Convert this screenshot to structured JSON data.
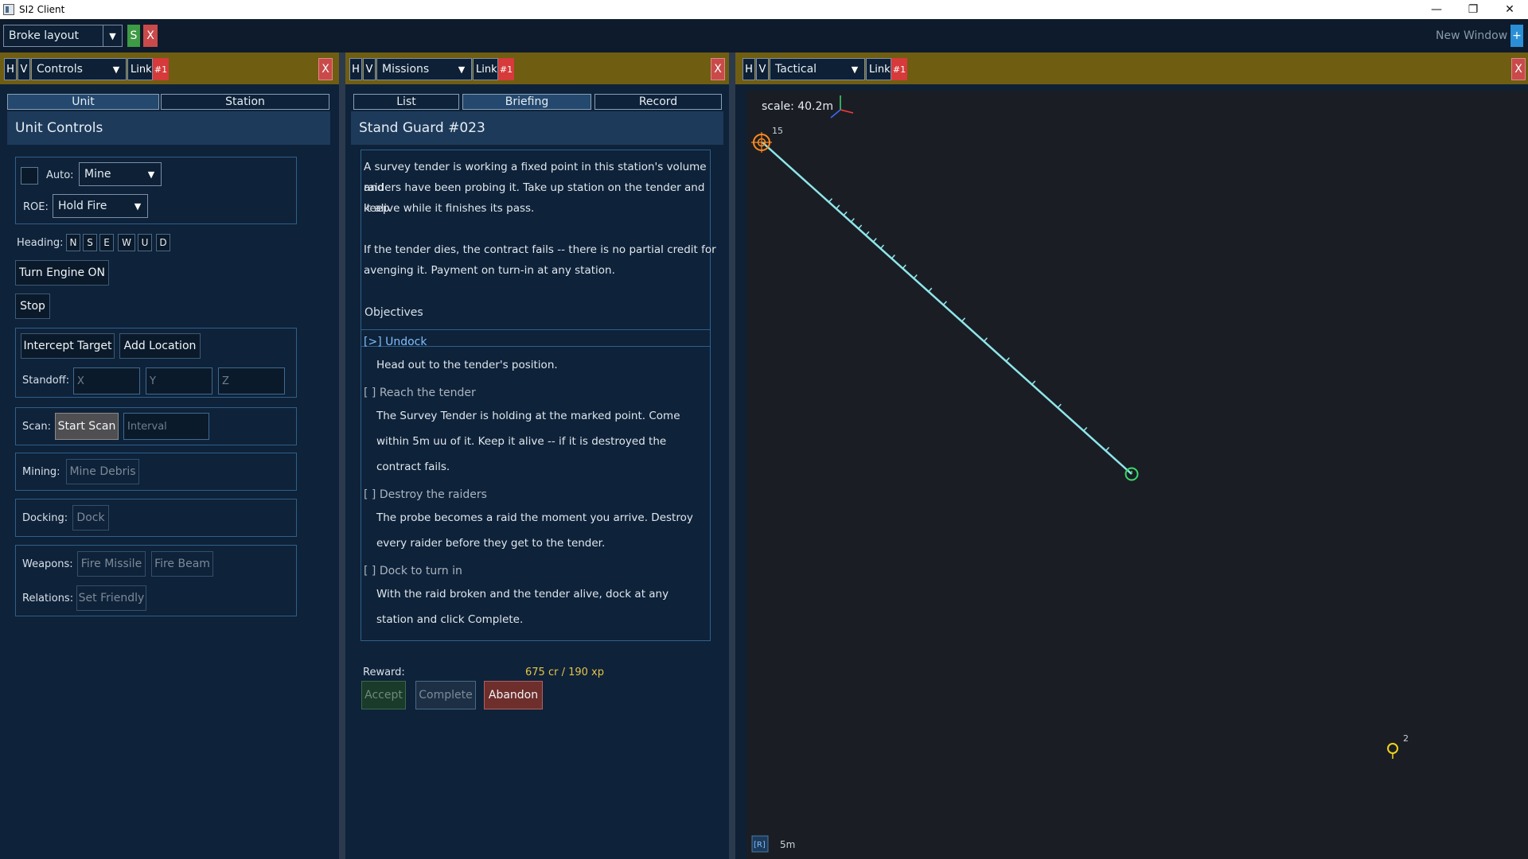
{
  "window": {
    "title": "SI2 Client",
    "controls": [
      "—",
      "❐",
      "✕"
    ]
  },
  "toolbar": {
    "layout_value": "Broke layout",
    "save_label": "S",
    "close_label": "X",
    "new_window_label": "New Window",
    "new_window_plus": "+"
  },
  "panel_header": {
    "h": "H",
    "v": "V",
    "link": "Link",
    "badge": "#1",
    "close": "X"
  },
  "controls": {
    "view_value": "Controls",
    "tabs": [
      "Unit",
      "Station"
    ],
    "title": "Unit Controls",
    "auto_label": "Auto:",
    "auto_value": "Mine",
    "roe_label": "ROE:",
    "roe_value": "Hold Fire",
    "heading_label": "Heading:",
    "headings": [
      "N",
      "S",
      "E",
      "W",
      "U",
      "D"
    ],
    "engine_button": "Turn Engine ON",
    "stop_button": "Stop",
    "intercept_button": "Intercept Target",
    "add_location_button": "Add Location",
    "standoff_label": "Standoff:",
    "standoff_placeholders": [
      "X",
      "Y",
      "Z"
    ],
    "scan_label": "Scan:",
    "start_scan_button": "Start Scan",
    "interval_placeholder": "Interval",
    "mining_label": "Mining:",
    "mine_debris_button": "Mine Debris",
    "docking_label": "Docking:",
    "dock_button": "Dock",
    "weapons_label": "Weapons:",
    "fire_missile_button": "Fire Missile",
    "fire_beam_button": "Fire Beam",
    "relations_label": "Relations:",
    "set_friendly_button": "Set Friendly"
  },
  "missions": {
    "view_value": "Missions",
    "tabs": [
      "List",
      "Briefing",
      "Record"
    ],
    "active_tab": "Briefing",
    "title": "Stand Guard #023",
    "desc_lines": [
      "A survey tender is working a fixed point in this station's volume and",
      "raiders have been probing it. Take up station on the tender and keep",
      "it alive while it finishes its pass.",
      "",
      "If the tender dies, the contract fails -- there is no partial credit for",
      "avenging it. Payment on turn-in at any station."
    ],
    "objectives_label": "Objectives",
    "objectives": [
      {
        "head": "[>] Undock",
        "current": true,
        "lines": [
          "Head out to the tender's position."
        ]
      },
      {
        "head": "[ ] Reach the tender",
        "current": false,
        "lines": [
          "The Survey Tender is holding at the marked point. Come",
          "within 5m uu of it. Keep it alive -- if it is destroyed the",
          "contract fails."
        ]
      },
      {
        "head": "[ ] Destroy the raiders",
        "current": false,
        "lines": [
          "The probe becomes a raid the moment you arrive. Destroy",
          "every raider before they get to the tender."
        ]
      },
      {
        "head": "[ ] Dock to turn in",
        "current": false,
        "lines": [
          "With the raid broken and the tender alive, dock at any",
          "station and click Complete."
        ]
      }
    ],
    "reward_label": "Reward:",
    "reward_value": "675 cr / 190 xp",
    "accept_button": "Accept",
    "complete_button": "Complete",
    "abandon_button": "Abandon"
  },
  "tactical": {
    "view_value": "Tactical",
    "scale_text": "scale: 40.2m",
    "markers": [
      {
        "name": "origin-marker",
        "label": "15",
        "color": "#ff8a1e"
      },
      {
        "name": "target-marker",
        "label": "",
        "color": "#3bd96b"
      },
      {
        "name": "contact-marker",
        "label": "2",
        "color": "#f2d21b"
      }
    ],
    "reset_label": "[R]",
    "grid_label": "5m",
    "path_color": "#8fe6ea"
  }
}
